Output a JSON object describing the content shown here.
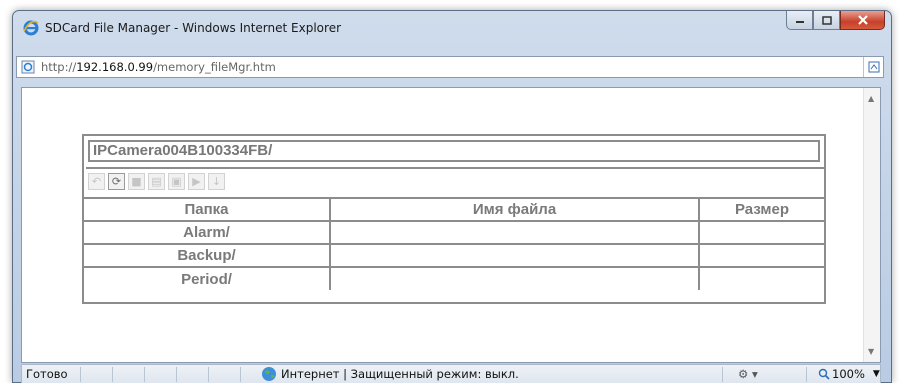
{
  "window": {
    "title": "SDCard File Manager - Windows Internet Explorer",
    "minimize_icon": "minimize-icon",
    "maximize_icon": "maximize-icon",
    "close_icon": "close-icon"
  },
  "address": {
    "prefix": "http://",
    "host": "192.168.0.99",
    "path": "/memory_fileMgr.htm",
    "page_icon": "page-icon",
    "compat_icon": "compatibility-view-icon"
  },
  "file_manager": {
    "path": "IPCamera004B100334FB/",
    "toolbar_icons": [
      "back-icon",
      "refresh-icon",
      "delete-icon",
      "download-icon",
      "copy-icon",
      "play-icon",
      "save-icon"
    ],
    "columns": [
      "Папка",
      "Имя файла",
      "Размер"
    ],
    "rows": [
      {
        "folder": "Alarm/",
        "file": "",
        "size": ""
      },
      {
        "folder": "Backup/",
        "file": "",
        "size": ""
      },
      {
        "folder": "Period/",
        "file": "",
        "size": ""
      }
    ]
  },
  "status": {
    "ready": "Готово",
    "zone": "Интернет | Защищенный режим: выкл.",
    "zoom": "100%",
    "globe_icon": "globe-icon",
    "zoom_icon": "zoom-icon"
  },
  "colors": {
    "border": "#8c8c8c",
    "text": "#7a7a7a",
    "close_button": "#c7402a"
  }
}
